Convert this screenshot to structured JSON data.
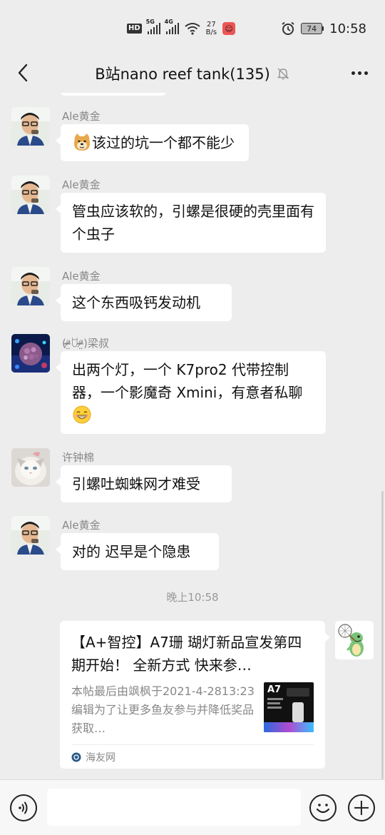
{
  "status_bar": {
    "network_badge": "HD",
    "signal1_label": "5G",
    "signal2_label": "4G",
    "speed_value": "27",
    "speed_unit": "B/s",
    "battery": "74",
    "time": "10:58"
  },
  "nav": {
    "title": "B站nano reef tank(135)"
  },
  "messages": [
    {
      "sender": "Ale黄金",
      "text": "该过的坑一个都不能少",
      "leading_emoji": "doge-emoji"
    },
    {
      "sender": "Ale黄金",
      "text": "管虫应该软的，引螺是很硬的壳里面有个虫子"
    },
    {
      "sender": "Ale黄金",
      "text": "这个东西吸钙发动机"
    },
    {
      "sender": "(ᵒ̴̶̷̤ꇴᵒ̴̶̷̤)梁叔",
      "text": "出两个灯，一个 K7pro2 代带控制器，一个影魔奇 Xmini，有意者私聊",
      "trailing_emoji": "grin-emoji"
    },
    {
      "sender": "许钟棉",
      "text": "引螺吐蜘蛛网才难受"
    },
    {
      "sender": "Ale黄金",
      "text": "对的 迟早是个隐患"
    }
  ],
  "timestamp": "晚上10:58",
  "link_card": {
    "title": "【A+智控】A7珊 瑚灯新品宣发第四期开始！ 全新方式  快来参…",
    "description": "本帖最后由飒枫于2021-4-2813:23编辑为了让更多鱼友参与并降低奖品获取…",
    "thumb_text": "A7",
    "source": "海友网"
  },
  "input": {
    "placeholder": ""
  },
  "colors": {
    "background": "#ededed",
    "bubble": "#ffffff",
    "meta_text": "#888888"
  }
}
